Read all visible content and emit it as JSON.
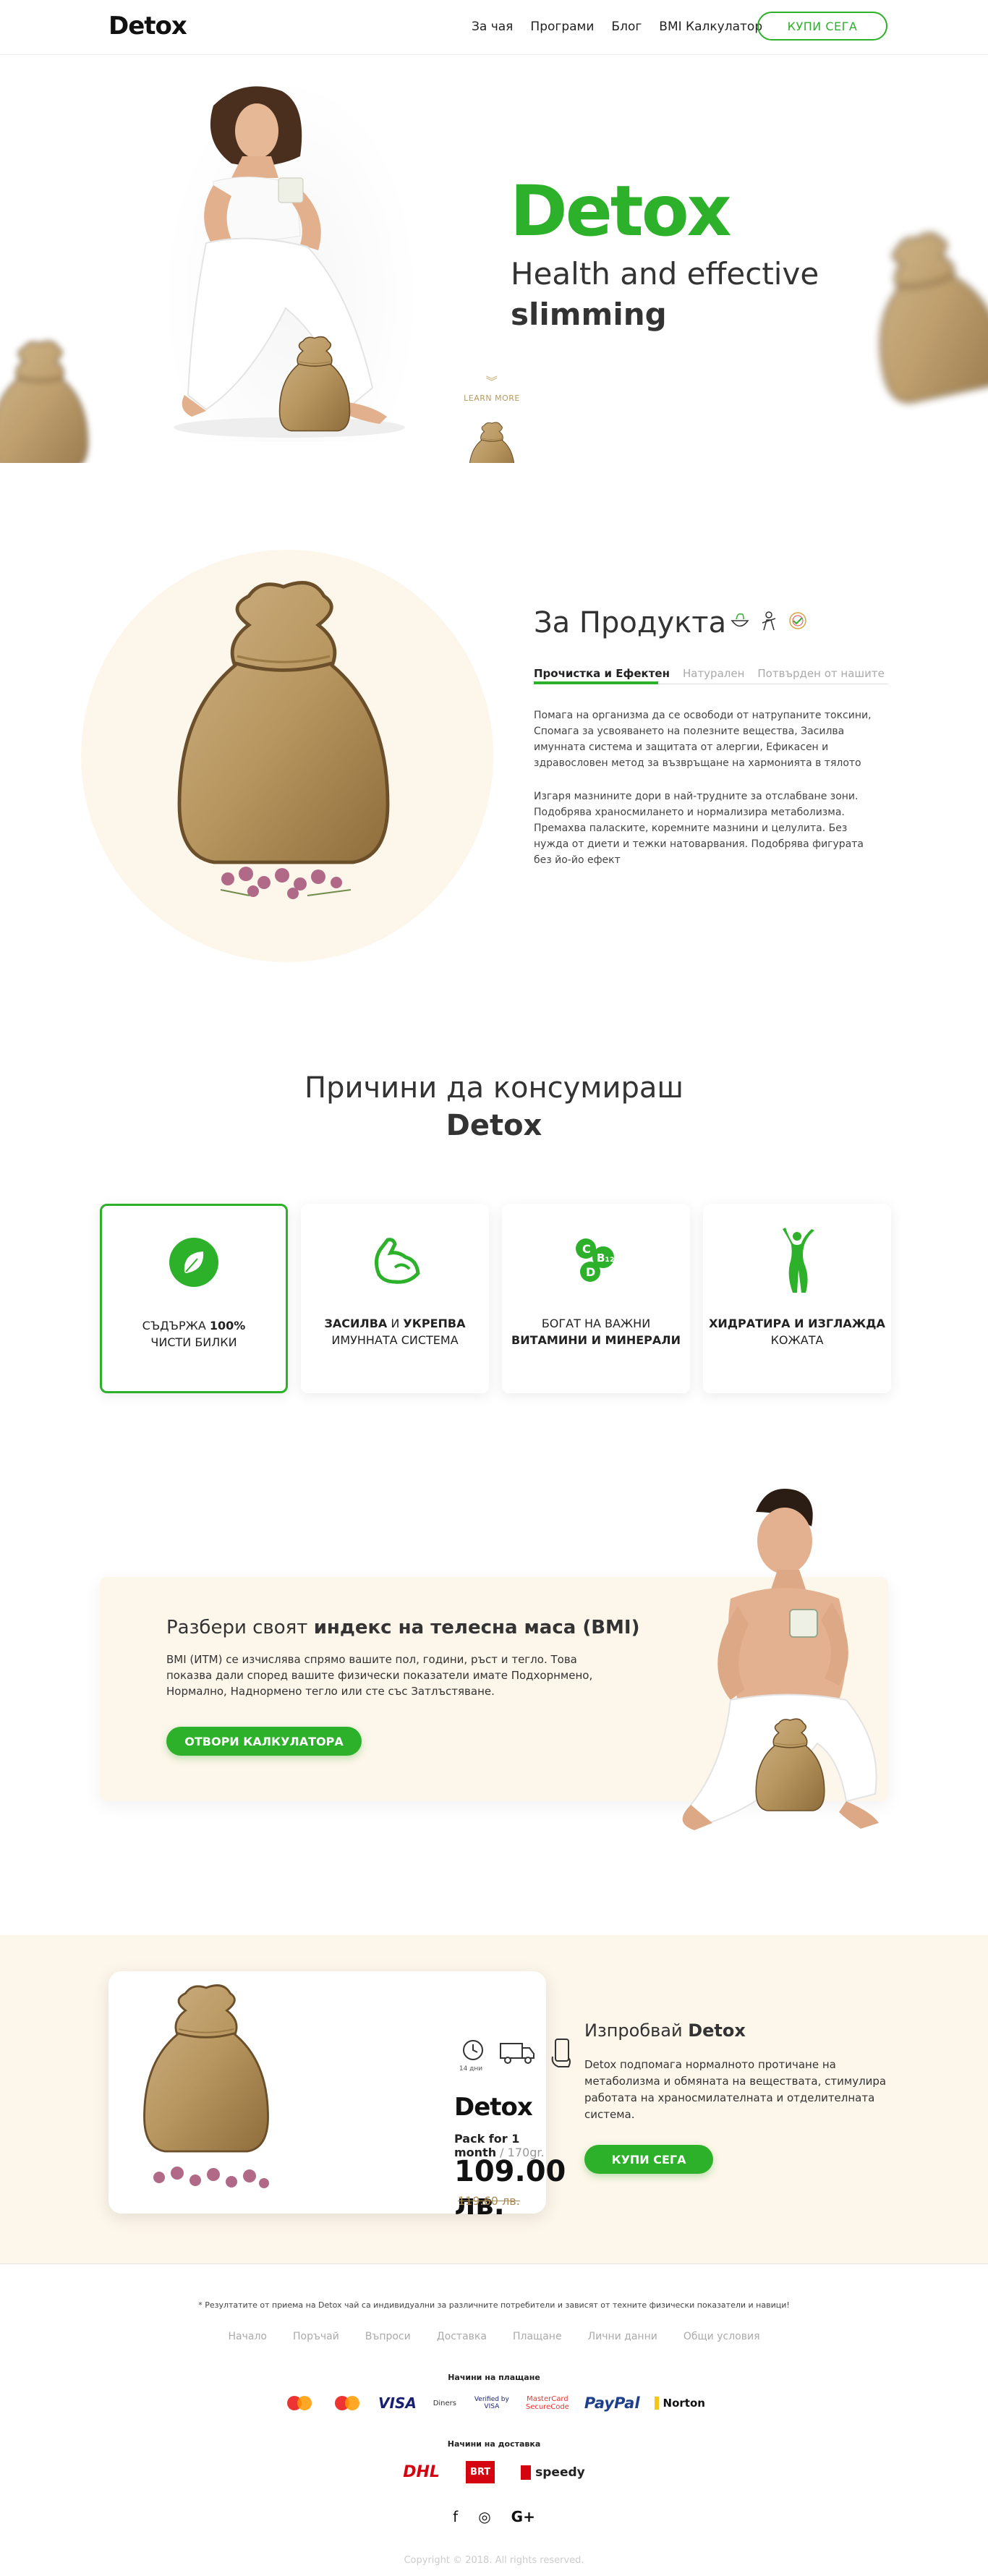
{
  "header": {
    "logo": "Detox",
    "nav": [
      "За чая",
      "Програми",
      "Блог",
      "BMI Калкулатор"
    ],
    "cta": "КУПИ СЕГА"
  },
  "hero": {
    "title": "Detox",
    "subtitle_line1": "Health and effective",
    "subtitle_line2": "slimming",
    "learn_more": "LEARN MORE"
  },
  "about": {
    "title": "За Продукта",
    "icons": [
      "bowl-herbs-icon",
      "person-icon",
      "seal-check-icon"
    ],
    "tabs": [
      "Прочистка и Ефектен",
      "Натурален",
      "Потвърден от нашите"
    ],
    "paragraph1": "Помага на организма да се освободи от натрупаните токсини, Спомага за усвояването на полезните вещества, Засилва имунната система и защитата от алергии, Ефикасен и здравословен метод за възвръщане на хармонията в тялото",
    "paragraph2": "Изгаря мазнините дори в най-трудните за отслабване зони. Подобрява храносмилането и нормализира метаболизма. Премахва паласките, коремните мазнини и целулита. Без нужда от диети и тежки натоварвания. Подобрява фигурата без йо-йо ефект"
  },
  "reasons": {
    "title_line1": "Причини да консумираш",
    "title_line2": "Detox",
    "cards": [
      {
        "pre": "СЪДЪРЖА ",
        "bold": "100%",
        "post": "",
        "line2": "ЧИСТИ БИЛКИ",
        "icon": "leaf-icon"
      },
      {
        "pre": "",
        "bold": "ЗАСИЛВА",
        "post": " И ",
        "bold2": "УКРЕПВА",
        "line2": "ИМУННАТА СИСТЕМА",
        "icon": "muscle-arm-icon"
      },
      {
        "pre": "БОГАТ НА ВАЖНИ",
        "line2": "ВИТАМИНИ И МИНЕРАЛИ",
        "icon": "vitamins-icon"
      },
      {
        "bold": "ХИДРАТИРА И ИЗГЛАЖДА",
        "line2": "КОЖАТА",
        "icon": "body-silhouette-icon"
      }
    ]
  },
  "bmi": {
    "title_pre": "Разбери своят ",
    "title_bold": "индекс на телесна маса (BMI)",
    "text": "BMI (ИТМ) се изчислява спрямо вашите пол, години, ръст и тегло. Това показва дали според вашите физически показатели имате Подхорнмено, Нормално, Наднормено тегло или сте със Затлъстяване.",
    "button": "ОТВОРИ КАЛКУЛАТОРА"
  },
  "try": {
    "icons": [
      {
        "name": "clock-icon",
        "label": "14 дни"
      },
      {
        "name": "delivery-truck-icon",
        "label": ""
      },
      {
        "name": "phone-hand-icon",
        "label": ""
      }
    ],
    "product_name": "Detox",
    "pack": "Pack for 1 month",
    "weight": " / 170gr.",
    "price": "109.00 лв.",
    "old_price": "119.60 лв.",
    "title_pre": "Изпробвай ",
    "title_bold": "Detox",
    "text": "Detox подпомага нормалното протичане на метаболизма и обмяната на веществата, стимулира работата на храносмилателната и отделителната система.",
    "button": "КУПИ СЕГА"
  },
  "footer": {
    "disclaimer": "* Резултатите от приема на Detox чай са индивидуални за различните потребители и зависят от техните физически показатели и навици!",
    "links": [
      "Начало",
      "Поръчай",
      "Въпроси",
      "Доставка",
      "Плащане",
      "Лични данни",
      "Общи условия"
    ],
    "payment_label": "Начини на плащане",
    "payments": [
      "Maestro",
      "MasterCard",
      "VISA",
      "Diners",
      "Verified by VISA",
      "MasterCard SecureCode",
      "PayPal",
      "Norton"
    ],
    "shipping_label": "Начини на доставка",
    "shipping": [
      "DHL",
      "BRT",
      "speedy"
    ],
    "social": [
      "facebook-icon",
      "instagram-icon",
      "google-plus-icon"
    ],
    "copyright": "Copyright © 2018. All rights reserved."
  },
  "colors": {
    "accent": "#2db02a",
    "cream": "#fdf6ea",
    "gold": "#b79a5e"
  }
}
